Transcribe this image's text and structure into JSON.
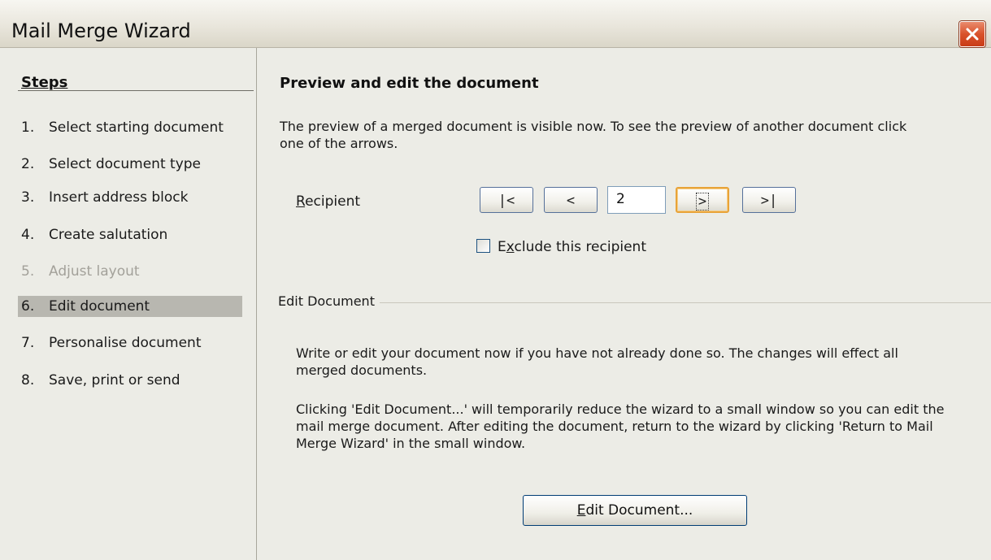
{
  "window": {
    "title": "Mail Merge Wizard",
    "close_icon": "close-x-icon",
    "close_color": "#d9522c"
  },
  "steps": {
    "title": "Steps",
    "items": [
      {
        "num": "1.",
        "label": "Select starting document",
        "state": "normal"
      },
      {
        "num": "2.",
        "label": "Select document type",
        "state": "normal"
      },
      {
        "num": "3.",
        "label": "Insert address block",
        "state": "normal"
      },
      {
        "num": "4.",
        "label": "Create salutation",
        "state": "normal"
      },
      {
        "num": "5.",
        "label": "Adjust layout",
        "state": "disabled"
      },
      {
        "num": "6.",
        "label": "Edit document",
        "state": "active"
      },
      {
        "num": "7.",
        "label": "Personalise document",
        "state": "normal"
      },
      {
        "num": "8.",
        "label": "Save, print or send",
        "state": "normal"
      }
    ]
  },
  "main": {
    "title": "Preview and edit the document",
    "preview_text_line1": "The preview of a merged document is visible now. To see the preview of another document click",
    "preview_text_line2": "one of the arrows.",
    "recipient": {
      "label_mnemonic": "R",
      "label_rest": "ecipient",
      "first_label": "|<",
      "prev_label": "<",
      "value": "2",
      "next_label": ">",
      "last_label": ">|"
    },
    "exclude": {
      "label_pre": "E",
      "label_mnemonic": "x",
      "label_rest": "clude this recipient",
      "checked": false
    },
    "edit_group": {
      "label": "Edit Document",
      "para1_line1": "Write or edit your document now if you have not already done so. The changes will effect all",
      "para1_line2": "merged documents.",
      "para2_line1": "Clicking 'Edit Document...' will temporarily reduce the wizard to a small window so you can edit the",
      "para2_line2": "mail merge document. After editing the document, return to the wizard by clicking 'Return to Mail",
      "para2_line3": "Merge Wizard' in the small window.",
      "button_mnemonic": "E",
      "button_rest": "dit Document..."
    }
  }
}
